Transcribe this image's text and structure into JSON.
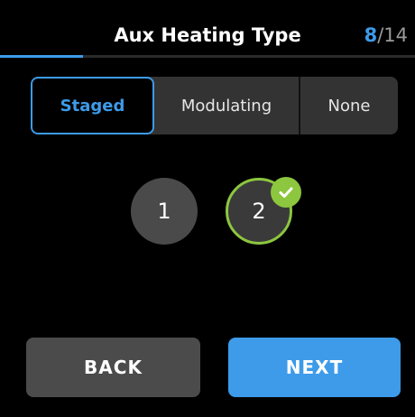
{
  "header": {
    "title": "Aux Heating Type",
    "step_current": "8",
    "step_separator": "/",
    "step_total": "14"
  },
  "progress": {
    "fraction": 0.2
  },
  "options": {
    "items": [
      {
        "label": "Staged",
        "selected": true
      },
      {
        "label": "Modulating",
        "selected": false
      },
      {
        "label": "None",
        "selected": false
      }
    ]
  },
  "stages": {
    "items": [
      {
        "label": "1",
        "selected": false
      },
      {
        "label": "2",
        "selected": true
      }
    ]
  },
  "footer": {
    "back_label": "BACK",
    "next_label": "NEXT"
  },
  "colors": {
    "accent": "#3d9be9",
    "selected_ring": "#8dc63f",
    "background": "#000000"
  },
  "icons": {
    "check": "check-icon"
  }
}
